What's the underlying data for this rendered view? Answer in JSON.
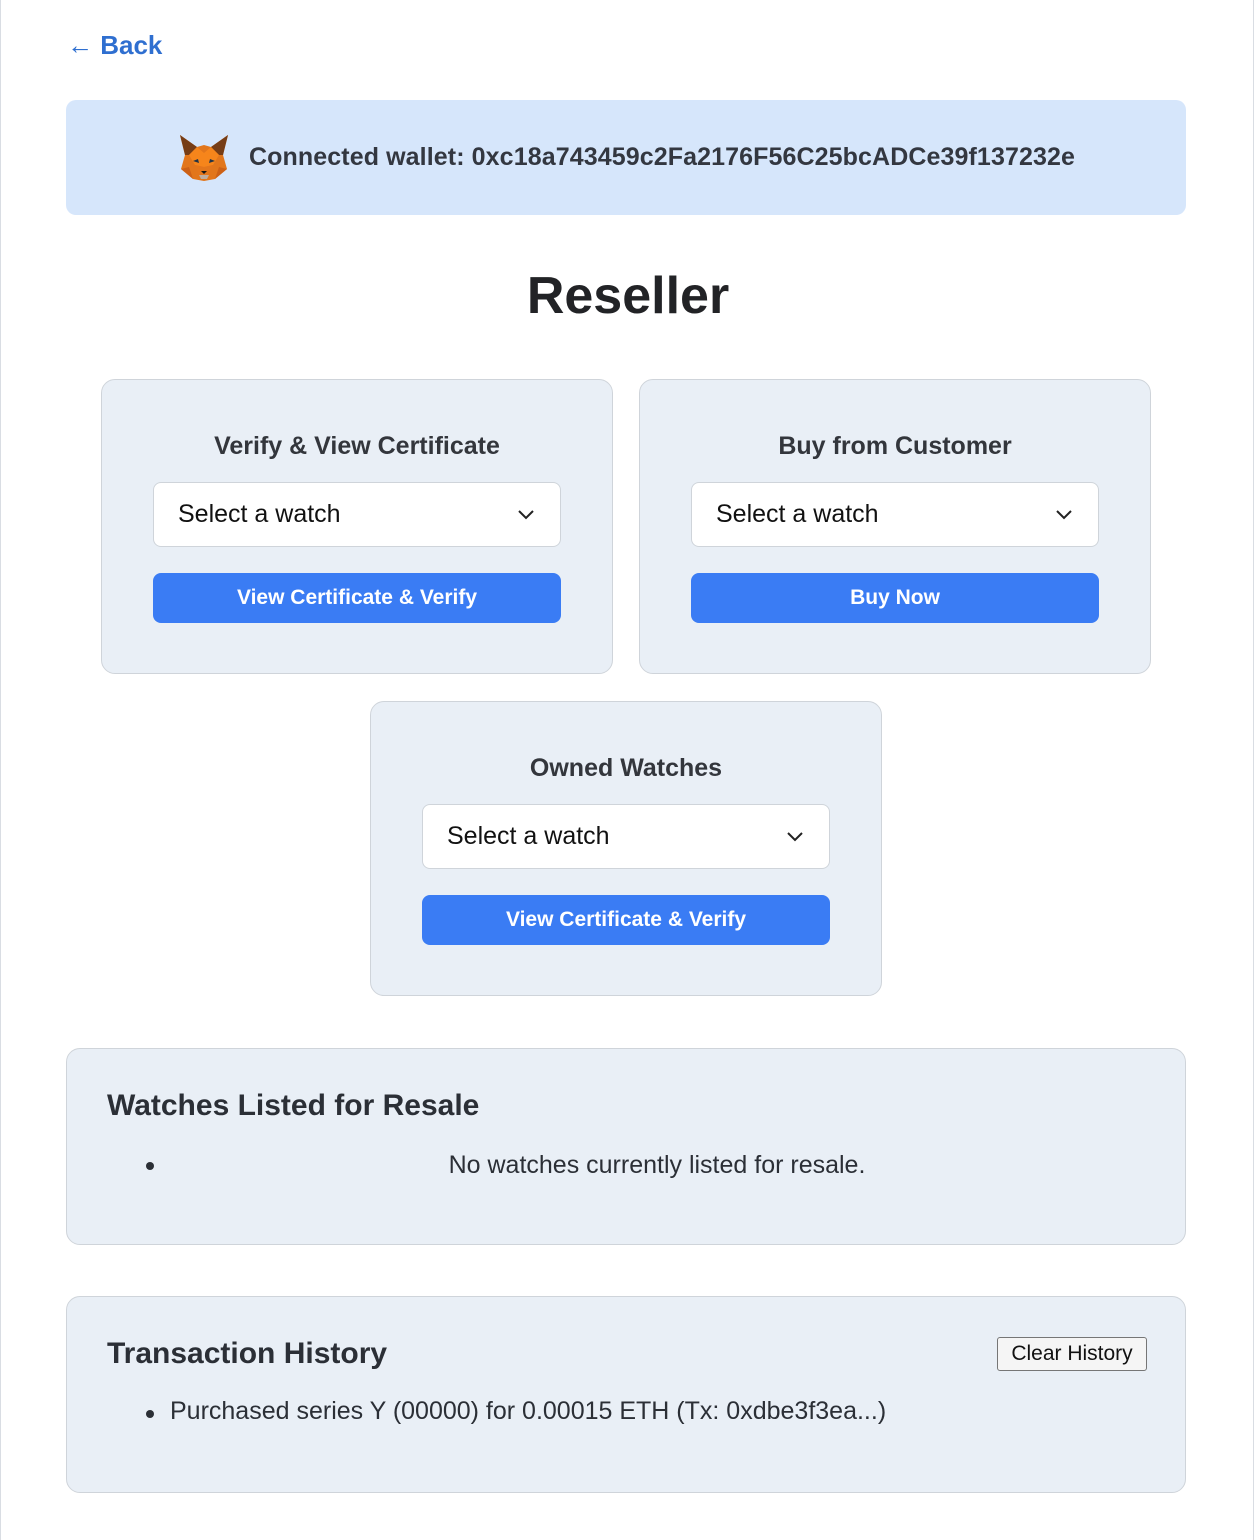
{
  "nav": {
    "back_label": "← Back"
  },
  "wallet": {
    "label": "Connected wallet: 0xc18a743459c2Fa2176F56C25bcADCe39f137232e",
    "icon": "metamask-fox-icon"
  },
  "page": {
    "title": "Reseller"
  },
  "cards": {
    "verify": {
      "title": "Verify & View Certificate",
      "select_value": "Select a watch",
      "button_label": "View Certificate & Verify"
    },
    "buy": {
      "title": "Buy from Customer",
      "select_value": "Select a watch",
      "button_label": "Buy Now"
    },
    "owned": {
      "title": "Owned Watches",
      "select_value": "Select a watch",
      "button_label": "View Certificate & Verify"
    }
  },
  "resale": {
    "title": "Watches Listed for Resale",
    "empty_text": "No watches currently listed for resale."
  },
  "history": {
    "title": "Transaction History",
    "clear_label": "Clear History",
    "items": [
      "Purchased series Y (00000) for 0.00015 ETH (Tx: 0xdbe3f3ea...)"
    ]
  },
  "colors": {
    "accent": "#3a7cf4",
    "link": "#2f6fd0",
    "banner": "#d6e6fb",
    "card": "#e9eff6"
  }
}
